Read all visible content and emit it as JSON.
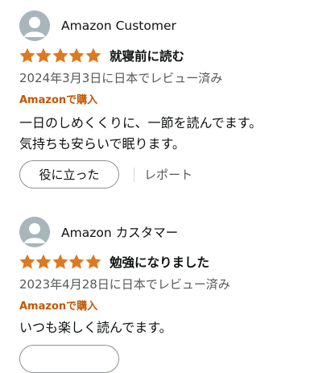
{
  "reviews": [
    {
      "reviewer_name": "Amazon Customer",
      "rating": 5,
      "rating_max": 5,
      "title": "就寝前に読む",
      "date": "2024年3月3日に日本でレビュー済み",
      "purchase_badge": "Amazonで購入",
      "body_lines": [
        "一日のしめくくりに、一節を読んでます。",
        "気持ちも安らいで眠ります。"
      ],
      "helpful_label": "役に立った",
      "report_label": "レポート"
    },
    {
      "reviewer_name": "Amazon カスタマー",
      "rating": 5,
      "rating_max": 5,
      "title": "勉強になりました",
      "date": "2023年4月28日に日本でレビュー済み",
      "purchase_badge": "Amazonで購入",
      "body_lines": [
        "いつも楽しく読んでます。"
      ]
    }
  ],
  "colors": {
    "star": "#de7921",
    "purchase_badge": "#c45500",
    "secondary_text": "#565959",
    "avatar_bg": "#a8b6bb"
  },
  "icons": {
    "avatar": "default-user-avatar-icon",
    "star": "filled-star-icon"
  }
}
